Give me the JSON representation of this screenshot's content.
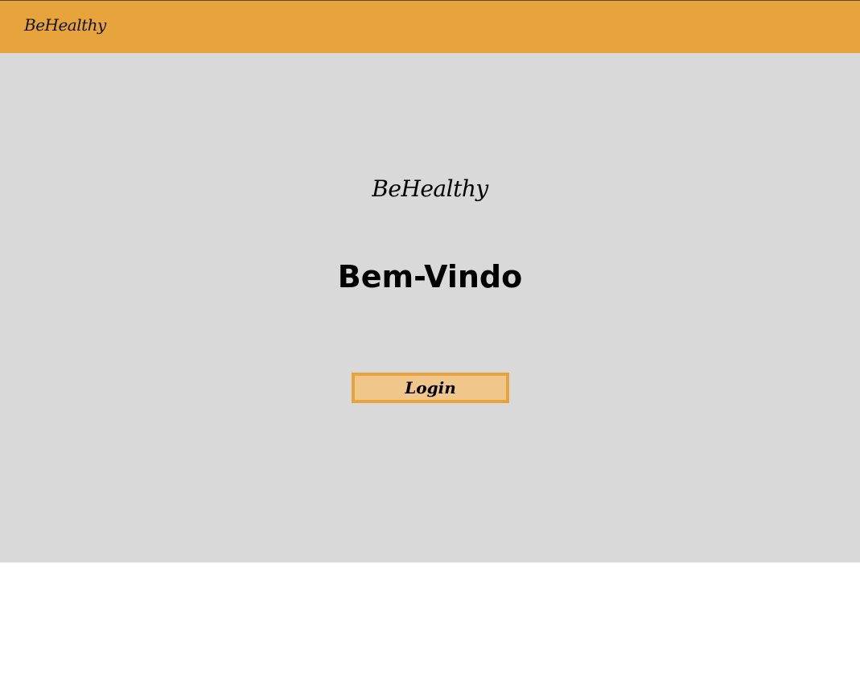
{
  "navbar": {
    "brand": "BeHealthy",
    "background_color": "#e8a43c"
  },
  "main": {
    "background_color": "#d9d9d9",
    "brand": "BeHealthy",
    "welcome_title": "Bem-Vindo",
    "login_button": {
      "label": "Login",
      "fill_color": "#f0c68a",
      "border_color": "#e8a43c"
    }
  }
}
